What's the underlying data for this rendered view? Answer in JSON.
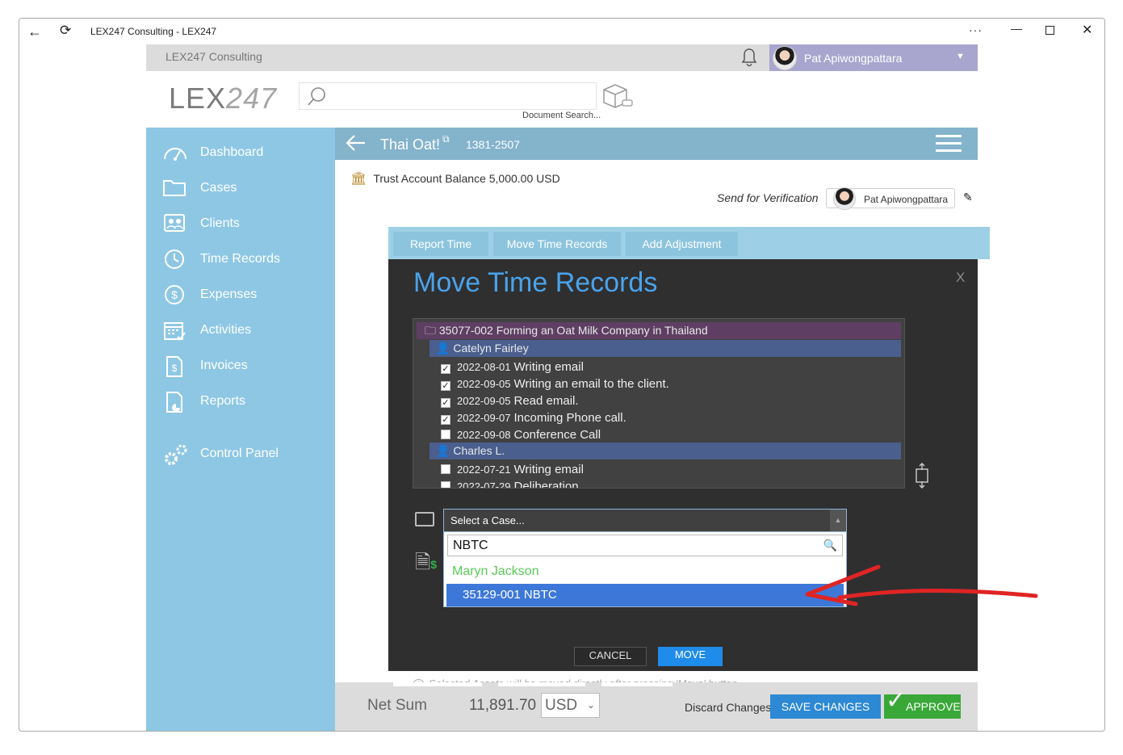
{
  "window": {
    "title": "LEX247 Consulting - LEX247",
    "more_glyph": "···",
    "min_glyph": "—",
    "close_glyph": "✕",
    "back_glyph": "←",
    "refresh_glyph": "⟳"
  },
  "header": {
    "org_name": "LEX247 Consulting",
    "user_name": "Pat Apiwongpattara",
    "logo_bold": "LEX",
    "logo_light": "247",
    "search_placeholder": "",
    "document_search_label": "Document Search..."
  },
  "sidebar": {
    "items": [
      {
        "label": "Dashboard",
        "icon": "dashboard-icon"
      },
      {
        "label": "Cases",
        "icon": "folder-icon"
      },
      {
        "label": "Clients",
        "icon": "clients-icon"
      },
      {
        "label": "Time Records",
        "icon": "clock-icon"
      },
      {
        "label": "Expenses",
        "icon": "dollar-icon"
      },
      {
        "label": "Activities",
        "icon": "calendar-icon"
      },
      {
        "label": "Invoices",
        "icon": "invoice-icon"
      },
      {
        "label": "Reports",
        "icon": "report-icon"
      },
      {
        "label": "Control Panel",
        "icon": "gears-icon"
      }
    ]
  },
  "page": {
    "title": "Thai Oat!",
    "number": "1381-2507",
    "trust_balance": "Trust Account Balance 5,000.00 USD",
    "send_for_verification": "Send for Verification",
    "verifier_name": "Pat Apiwongpattara"
  },
  "tabs": [
    "Report Time",
    "Move Time Records",
    "Add Adjustment"
  ],
  "modal": {
    "title": "Move Time Records",
    "close_label": "X",
    "tree": {
      "case": "35077-002 Forming an Oat Milk Company in Thailand",
      "people": [
        {
          "name": "Catelyn Fairley",
          "entries": [
            {
              "date": "2022-08-01",
              "text": "Writing email",
              "checked": true
            },
            {
              "date": "2022-09-05",
              "text": "Writing an email to the client.",
              "checked": true
            },
            {
              "date": "2022-09-05",
              "text": "Read email.",
              "checked": true
            },
            {
              "date": "2022-09-07",
              "text": "Incoming Phone call.",
              "checked": true
            },
            {
              "date": "2022-09-08",
              "text": "Conference Call",
              "checked": false
            }
          ]
        },
        {
          "name": "Charles L.",
          "entries": [
            {
              "date": "2022-07-21",
              "text": "Writing email",
              "checked": false
            },
            {
              "date": "2022-07-29",
              "text": "Deliberation",
              "checked": false
            }
          ]
        }
      ]
    },
    "case_select": {
      "placeholder": "Select a Case...",
      "search_value": "NBTC",
      "group_label": "Maryn Jackson",
      "option_label": "35129-001 NBTC"
    },
    "cancel_label": "CANCEL",
    "move_label": "MOVE",
    "note": "Selected Assets will be moved directly after pressing 'Move' button."
  },
  "footer": {
    "net_sum_label": "Net Sum",
    "net_sum_value": "11,891.70",
    "currency": "USD",
    "discard_label": "Discard Changes",
    "save_label": "SAVE CHANGES",
    "approve_label": "APPROVE"
  },
  "colors": {
    "sidebar": "#8ec7e4",
    "accent_blue": "#4aa3ea",
    "modal_bg": "#2f2f30",
    "approve_green": "#3aa839",
    "annotation_red": "#e02424"
  }
}
